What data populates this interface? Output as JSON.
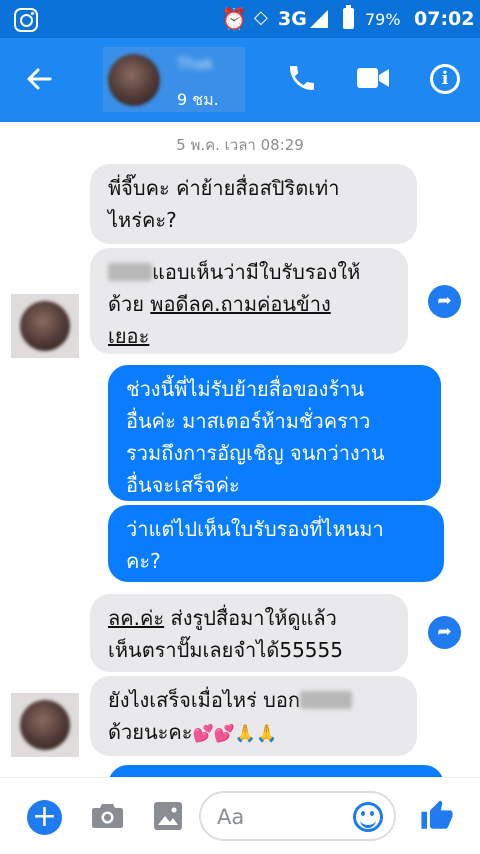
{
  "status_bar": {
    "network": "3G",
    "battery": "79%",
    "time": "07:02"
  },
  "header": {
    "contact_name": "Thak",
    "active_status": "9 ชม."
  },
  "chat": {
    "timestamp": "5 พ.ค. เวลา 08:29",
    "messages": [
      {
        "direction": "incoming",
        "lines": [
          "พี่จี๊บคะ ค่าย้ายสื่อสปิริตเท่า",
          "ไหร่คะ?"
        ]
      },
      {
        "direction": "incoming",
        "line1": "แอบเห็นว่ามีใบรับรองให้",
        "line2_prefix": "ด้วย ",
        "line2_link": "พอดีลค.ถามค่อนข้าง",
        "line3_link": "เยอะ"
      },
      {
        "direction": "outgoing",
        "lines": [
          "ช่วงนี้พี่ไม่รับย้ายสื่อของร้าน",
          "อื่นค่ะ มาสเตอร์ห้ามชั่วคราว",
          "รวมถึงการอัญเชิญ จนกว่างาน",
          "อื่นจะเสร็จค่ะ"
        ]
      },
      {
        "direction": "outgoing",
        "lines": [
          "ว่าแต่ไปเห็นใบรับรองที่ไหนมา",
          "คะ?"
        ]
      },
      {
        "direction": "incoming",
        "link": "ลค.ค่ะ",
        "line1_rest": " ส่งรูปสื่อมาให้ดูแล้ว",
        "line2": "เห็นตราปั๊มเลยจำได้55555"
      },
      {
        "direction": "incoming",
        "line1": "ยังไงเสร็จเมื่อไหร่ บอก",
        "line2": "ด้วยนะคะ",
        "emoji": "💕💕🙏🙏"
      }
    ]
  },
  "composer": {
    "placeholder": "Aa"
  },
  "colors": {
    "header_blue": "#1e88f2",
    "status_blue": "#0a72d9",
    "outgoing_bubble": "#0a7cff",
    "incoming_bubble": "#e9e9eb"
  },
  "icons": [
    "instagram-icon",
    "alarm-icon",
    "signal-icon",
    "battery-icon",
    "back-arrow-icon",
    "phone-icon",
    "video-camera-icon",
    "info-icon",
    "share-icon",
    "plus-icon",
    "camera-icon",
    "image-icon",
    "emoji-icon",
    "thumbs-up-icon"
  ]
}
